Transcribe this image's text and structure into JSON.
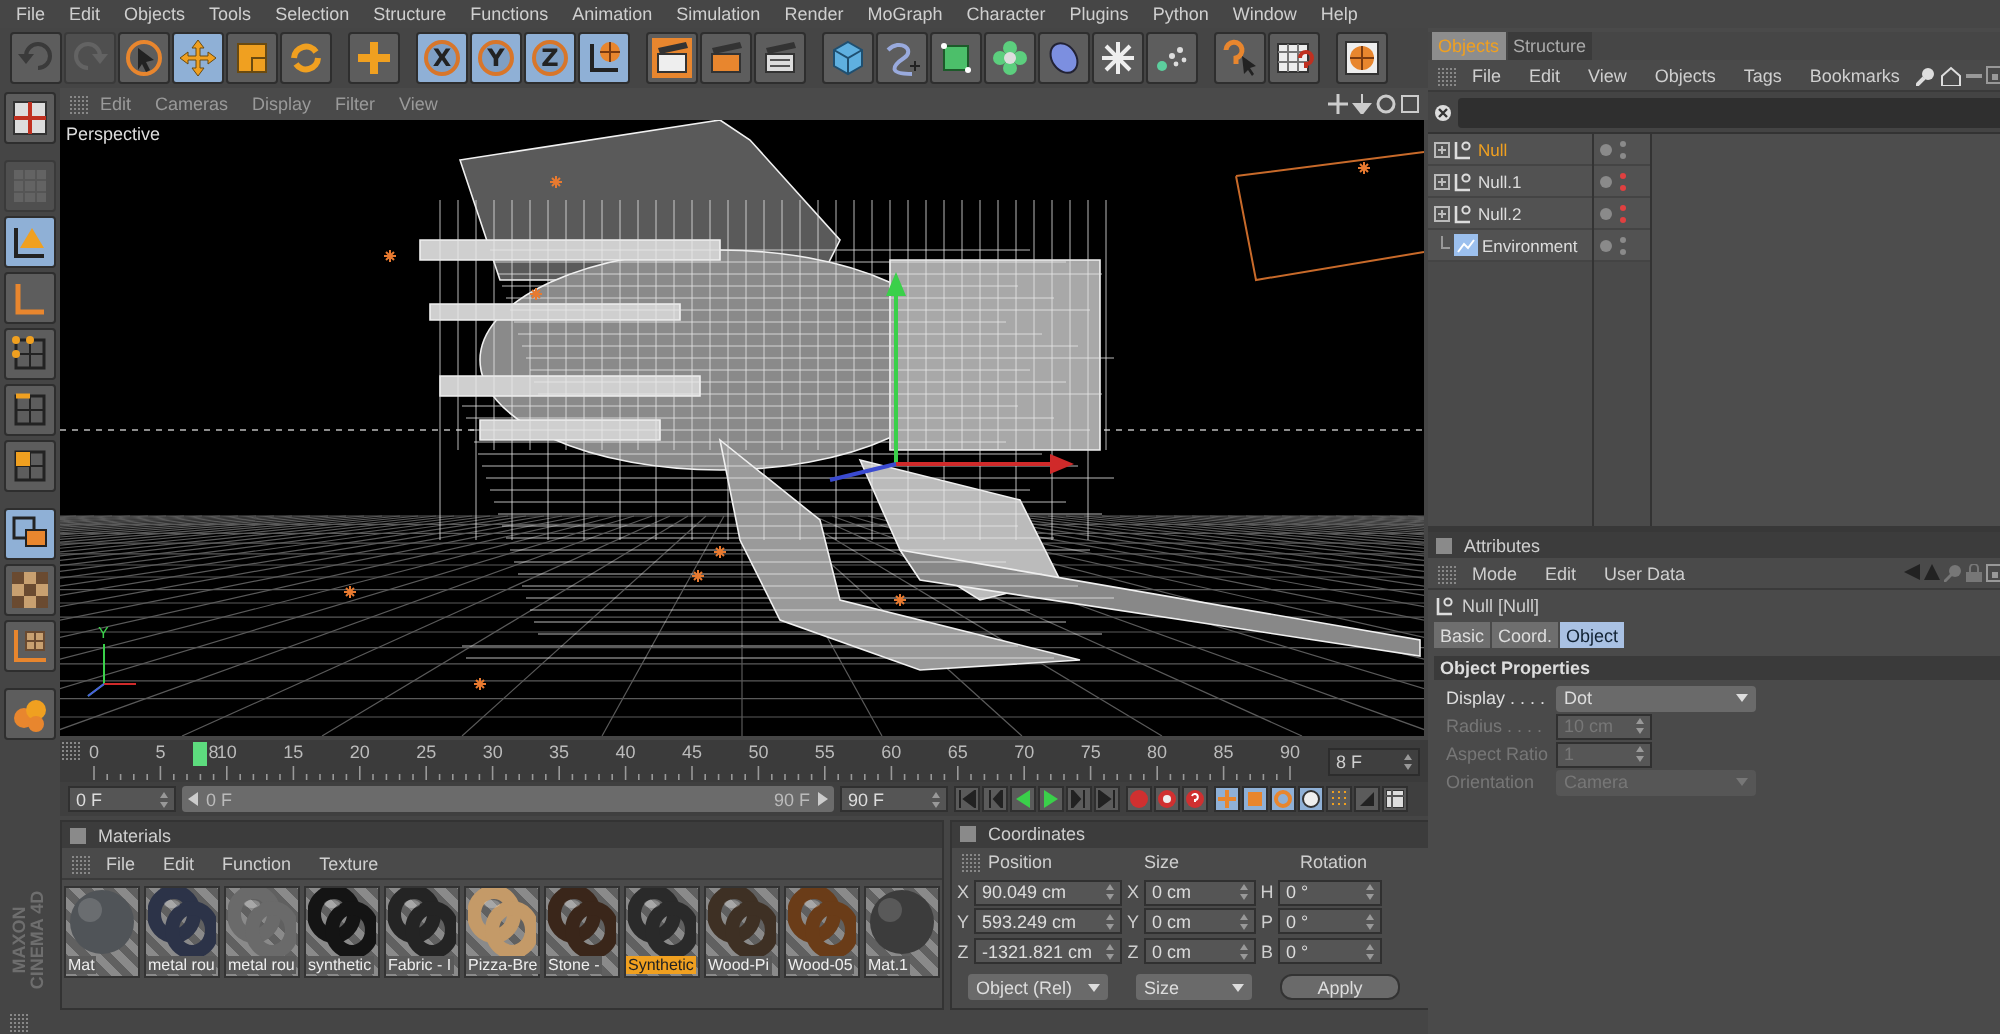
{
  "menu": [
    "File",
    "Edit",
    "Objects",
    "Tools",
    "Selection",
    "Structure",
    "Functions",
    "Animation",
    "Simulation",
    "Render",
    "MoGraph",
    "Character",
    "Plugins",
    "Python",
    "Window",
    "Help"
  ],
  "toolbar": [
    {
      "selected": false,
      "disabled": false
    },
    {
      "selected": false,
      "disabled": true
    },
    {
      "selected": false,
      "disabled": false
    },
    {
      "selected": true,
      "disabled": false
    },
    {
      "selected": false,
      "disabled": false
    },
    {
      "selected": false,
      "disabled": false
    },
    {
      "selected": false,
      "disabled": false
    },
    {
      "selected": true,
      "disabled": false,
      "label": "X"
    },
    {
      "selected": true,
      "disabled": false,
      "label": "Y"
    },
    {
      "selected": true,
      "disabled": false,
      "label": "Z"
    },
    {
      "selected": true,
      "disabled": false
    },
    {
      "selected": false,
      "disabled": false
    },
    {
      "selected": false,
      "disabled": false
    },
    {
      "selected": false,
      "disabled": false
    },
    {
      "selected": false,
      "disabled": false
    },
    {
      "selected": false,
      "disabled": false
    },
    {
      "selected": false,
      "disabled": false
    },
    {
      "selected": false,
      "disabled": false
    },
    {
      "selected": false,
      "disabled": false
    },
    {
      "selected": false,
      "disabled": false
    },
    {
      "selected": false,
      "disabled": false
    },
    {
      "selected": false,
      "disabled": false
    },
    {
      "selected": false,
      "disabled": false
    },
    {
      "selected": false,
      "disabled": false
    }
  ],
  "left_toolbar": [
    {
      "selected": false,
      "disabled": false
    },
    {
      "selected": false,
      "disabled": true
    },
    {
      "selected": true,
      "disabled": false
    },
    {
      "selected": false,
      "disabled": false
    },
    {
      "selected": false,
      "disabled": false
    },
    {
      "selected": false,
      "disabled": false
    },
    {
      "selected": false,
      "disabled": false
    },
    {
      "selected": true,
      "disabled": false
    },
    {
      "selected": false,
      "disabled": false
    },
    {
      "selected": false,
      "disabled": false
    },
    {
      "selected": false,
      "disabled": false
    }
  ],
  "logo": {
    "line1": "MAXON",
    "line2": "CINEMA 4D"
  },
  "viewport": {
    "menu": [
      "Edit",
      "Cameras",
      "Display",
      "Filter",
      "View"
    ],
    "camera": "Perspective",
    "axis_label": "Y"
  },
  "timeline": {
    "ticks": [
      "0",
      "5",
      "10",
      "15",
      "20",
      "25",
      "30",
      "35",
      "40",
      "45",
      "50",
      "55",
      "60",
      "65",
      "70",
      "75",
      "80",
      "85",
      "90"
    ],
    "current": "8",
    "level": 0.089,
    "frame": "8 F",
    "start": "0 F",
    "range": {
      "start": "0 F",
      "end": "90 F",
      "level": 1
    },
    "end": "90 F"
  },
  "materials": {
    "title": "Materials",
    "menu": [
      "File",
      "Edit",
      "Function",
      "Texture"
    ],
    "items": [
      {
        "name": "Mat",
        "kind": "sphere",
        "color": "#505458",
        "selected": false
      },
      {
        "name": "metal rou",
        "kind": "torus",
        "color": "#2c3348",
        "selected": false
      },
      {
        "name": "metal rou",
        "kind": "torus",
        "color": "#6a6a6a",
        "selected": false
      },
      {
        "name": "synthetic",
        "kind": "torus",
        "color": "#141414",
        "selected": false
      },
      {
        "name": "Fabric - I",
        "kind": "torus",
        "color": "#242424",
        "selected": false
      },
      {
        "name": "Pizza-Bre",
        "kind": "torus",
        "color": "#c49a68",
        "selected": false
      },
      {
        "name": "Stone -",
        "kind": "torus",
        "color": "#3a261a",
        "selected": false
      },
      {
        "name": "Synthetic",
        "kind": "torus",
        "color": "#2a2a2a",
        "selected": true
      },
      {
        "name": "Wood-Pi",
        "kind": "torus",
        "color": "#3e3024",
        "selected": false
      },
      {
        "name": "Wood-05",
        "kind": "torus",
        "color": "#6a3c18",
        "selected": false
      },
      {
        "name": "Mat.1",
        "kind": "sphere",
        "color": "#3c3c3c",
        "selected": false
      }
    ]
  },
  "coordinates": {
    "title": "Coordinates",
    "headers": [
      "Position",
      "Size",
      "Rotation"
    ],
    "rows": [
      {
        "p_axis": "X",
        "position": "90.049 cm",
        "s_axis": "X",
        "size": "0 cm",
        "r_axis": "H",
        "rotation": "0 °"
      },
      {
        "p_axis": "Y",
        "position": "593.249 cm",
        "s_axis": "Y",
        "size": "0 cm",
        "r_axis": "P",
        "rotation": "0 °"
      },
      {
        "p_axis": "Z",
        "position": "-1321.821 cm",
        "s_axis": "Z",
        "size": "0 cm",
        "r_axis": "B",
        "rotation": "0 °"
      }
    ],
    "mode": "Object (Rel)",
    "size_mode": "Size",
    "apply": "Apply"
  },
  "objects": {
    "tabs": [
      {
        "label": "Objects",
        "selected": true
      },
      {
        "label": "Structure",
        "selected": false
      }
    ],
    "menu": [
      "File",
      "Edit",
      "View",
      "Objects",
      "Tags",
      "Bookmarks"
    ],
    "tree": [
      {
        "name": "Null",
        "kind": "null",
        "selected": true,
        "expanded": false,
        "hidden": false
      },
      {
        "name": "Null.1",
        "kind": "null",
        "selected": false,
        "expanded": false,
        "hidden": true
      },
      {
        "name": "Null.2",
        "kind": "null",
        "selected": false,
        "expanded": false,
        "hidden": true
      },
      {
        "name": "Environment",
        "kind": "environment",
        "selected": false,
        "hidden": false
      }
    ]
  },
  "attributes": {
    "title": "Attributes",
    "menu": [
      "Mode",
      "Edit",
      "User Data"
    ],
    "object": "Null [Null]",
    "tabs": [
      {
        "label": "Basic",
        "selected": false
      },
      {
        "label": "Coord.",
        "selected": false
      },
      {
        "label": "Object",
        "selected": true
      }
    ],
    "section": "Object Properties",
    "fields": [
      {
        "label": "Display . . . .",
        "value": "Dot",
        "kind": "dropdown",
        "disabled": false
      },
      {
        "label": "Radius . . . .",
        "value": "10 cm",
        "kind": "number",
        "disabled": true
      },
      {
        "label": "Aspect Ratio",
        "value": "1",
        "kind": "number",
        "disabled": true
      },
      {
        "label": "Orientation",
        "value": "Camera",
        "kind": "dropdown",
        "disabled": true
      }
    ]
  }
}
